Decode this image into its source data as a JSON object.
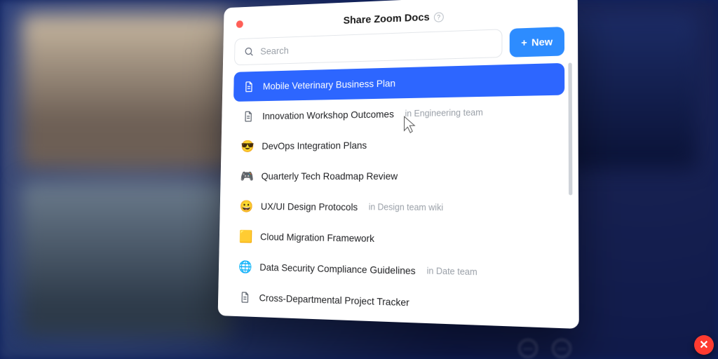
{
  "panel": {
    "title": "Share Zoom Docs",
    "help_glyph": "?",
    "search": {
      "placeholder": "Search"
    },
    "new_button": {
      "label": "New",
      "plus": "+"
    }
  },
  "docs": [
    {
      "icon": "doc",
      "title": "Mobile Veterinary Business Plan",
      "meta": "",
      "selected": true
    },
    {
      "icon": "doc",
      "title": "Innovation Workshop Outcomes",
      "meta": "in Engineering team",
      "selected": false
    },
    {
      "icon": "emoji-😎",
      "title": "DevOps Integration Plans",
      "meta": "",
      "selected": false
    },
    {
      "icon": "emoji-🎮",
      "title": "Quarterly Tech Roadmap Review",
      "meta": "",
      "selected": false
    },
    {
      "icon": "emoji-😀",
      "title": "UX/UI Design Protocols",
      "meta": "in Design team wiki",
      "selected": false
    },
    {
      "icon": "emoji-🟨",
      "title": "Cloud Migration Framework",
      "meta": "",
      "selected": false
    },
    {
      "icon": "emoji-🌐",
      "title": "Data Security Compliance Guidelines",
      "meta": "in Date team",
      "selected": false
    },
    {
      "icon": "doc",
      "title": "Cross-Departmental Project Tracker",
      "meta": "",
      "selected": false
    }
  ],
  "window": {
    "close_glyph": "✕"
  },
  "colors": {
    "accent_button": "#2d8cff",
    "selected_row": "#2d66ff",
    "close_red": "#ff3b30"
  }
}
